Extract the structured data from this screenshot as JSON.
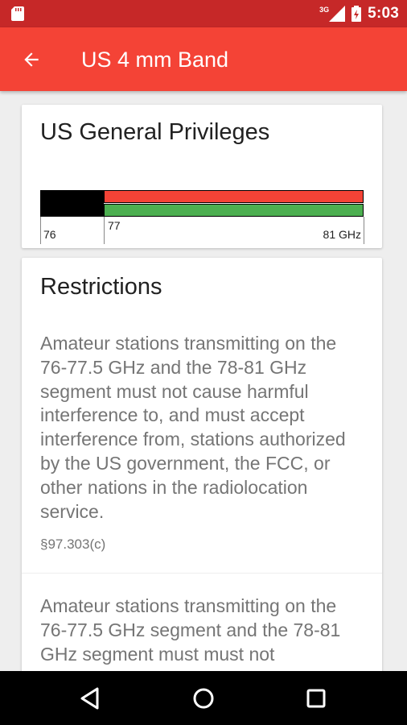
{
  "status_bar": {
    "time": "5:03",
    "network": "3G",
    "icons": [
      "sd-card-icon",
      "signal-icon",
      "battery-icon"
    ]
  },
  "app_bar": {
    "title": "US 4 mm Band",
    "back_icon": "arrow-back-icon"
  },
  "privileges_card": {
    "title": "US General Privileges",
    "band_chart": {
      "tick_labels": [
        "76",
        "77",
        "81 GHz"
      ],
      "segments": [
        {
          "start": 76,
          "end": 77,
          "color": "#000000"
        },
        {
          "start": 77,
          "end": 81,
          "color": "#f44336"
        },
        {
          "start": 77,
          "end": 81,
          "color": "#4caf50"
        }
      ]
    }
  },
  "restrictions_card": {
    "title": "Restrictions",
    "items": [
      {
        "text": "Amateur stations transmitting on the 76-77.5 GHz and the 78-81 GHz segment must not cause harmful interference to, and must accept interference from, stations authorized by the US government, the FCC, or other nations in the radiolocation service.",
        "reference": "§97.303(c)"
      },
      {
        "text": "Amateur stations transmitting on the 76-77.5 GHz segment and the 78-81 GHz segment must must not"
      }
    ]
  },
  "nav_bar": {
    "buttons": [
      "back-triangle-icon",
      "home-circle-icon",
      "recents-square-icon"
    ]
  },
  "colors": {
    "status_bar": "#c62828",
    "app_bar": "#f44336",
    "band_red": "#f44336",
    "band_green": "#4caf50"
  }
}
